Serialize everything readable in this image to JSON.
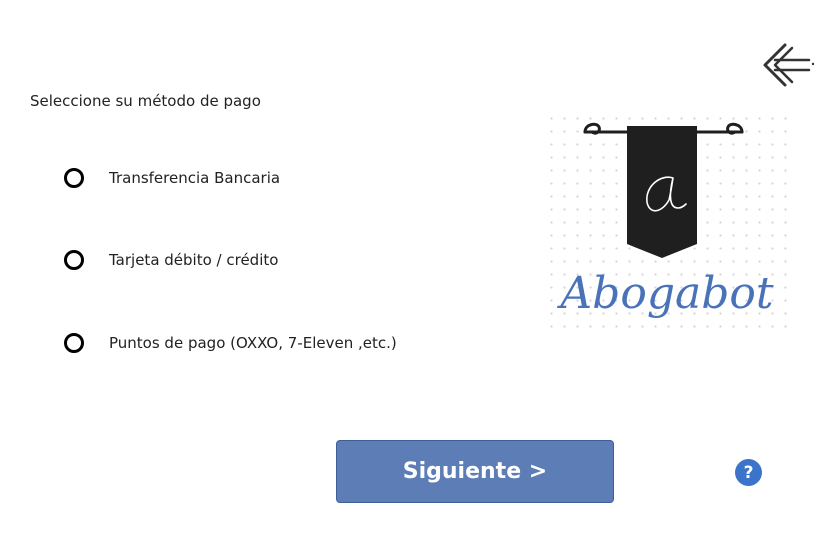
{
  "back_icon": "arrow-left-icon",
  "prompt": "Seleccione su método de pago",
  "payment_options": [
    {
      "label": "Transferencia Bancaria",
      "selected": false
    },
    {
      "label": "Tarjeta débito / crédito",
      "selected": false
    },
    {
      "label": "Puntos de pago (OXXO, 7-Eleven ,etc.)",
      "selected": false
    }
  ],
  "logo": {
    "banner_letter": "a",
    "wordmark": "Abogabot",
    "banner_color": "#1f1f1f",
    "wordmark_color": "#4a72b8"
  },
  "next_button": "Siguiente >",
  "help_button": "?",
  "colors": {
    "primary_button": "#5c7db5",
    "help_button": "#3b74c9"
  }
}
